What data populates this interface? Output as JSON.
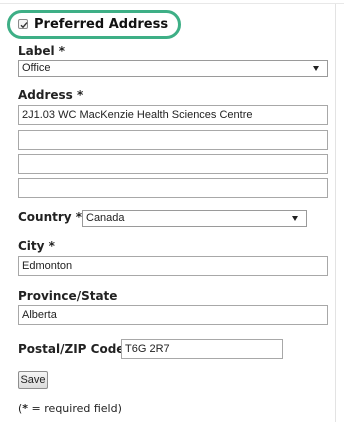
{
  "preferred": {
    "label": "Preferred Address",
    "checked": true
  },
  "label_field": {
    "label": "Label *",
    "value": "Office"
  },
  "address": {
    "label": "Address *",
    "lines": [
      "2J1.03 WC MacKenzie Health Sciences Centre",
      "",
      "",
      ""
    ]
  },
  "country": {
    "label": "Country *",
    "value": "Canada"
  },
  "city": {
    "label": "City *",
    "value": "Edmonton"
  },
  "province": {
    "label": "Province/State",
    "value": "Alberta"
  },
  "postal": {
    "label": "Postal/ZIP Code",
    "value": "T6G 2R7"
  },
  "save_label": "Save",
  "footnote": {
    "star": "*",
    "text": " = required field)"
  },
  "colors": {
    "highlight": "#3eaf86"
  },
  "icons": {
    "select_arrow": "chevron-down-icon",
    "checkbox": "checkmark-icon"
  }
}
